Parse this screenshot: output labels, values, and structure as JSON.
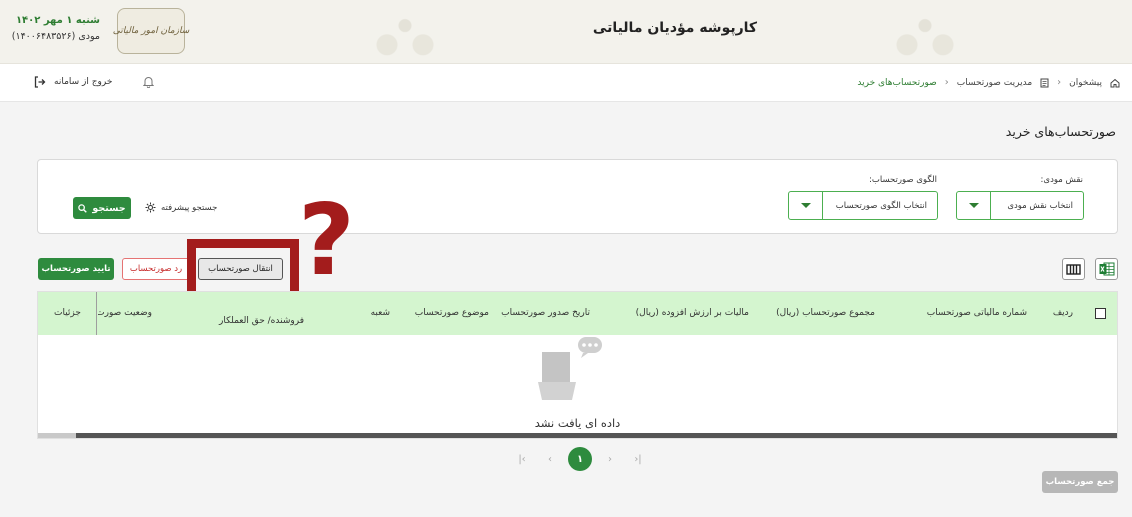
{
  "header": {
    "title": "کارپوشه مؤدیان مالیاتی",
    "date": "شنبه ۱ مهر ۱۴۰۲",
    "user": "مودی (۱۴۰۰۶۴۸۳۵۲۶)",
    "logo_text": "سازمان امور مالیاتی"
  },
  "nav": {
    "logout_label": "خروج از سامانه",
    "breadcrumb": [
      "پیشخوان",
      "مدیریت صورتحساب",
      "صورتحساب‌های خرید"
    ]
  },
  "page": {
    "title": "صورتحساب‌های خرید"
  },
  "filters": {
    "role_label": "نقش مودی:",
    "role_value": "انتخاب نقش مودی",
    "pattern_label": "الگوی صورتحساب:",
    "pattern_value": "انتخاب الگوی صورتحساب",
    "advanced_label": "جستجو پیشرفته",
    "search_label": "جستجو"
  },
  "actions": {
    "confirm_label": "تایید صورتحساب",
    "reject_label": "رد صورتحساب",
    "transfer_label": "انتقال صورتحساب",
    "sum_label": "جمع صورتحساب"
  },
  "annotation": {
    "question": "?"
  },
  "table": {
    "columns": [
      "ردیف",
      "شماره مالیاتی صورتحساب",
      "مجموع صورتحساب (ریال)",
      "مالیات بر ارزش افزوده (ریال)",
      "تاریخ صدور صورتحساب",
      "موضوع صورتحساب",
      "شعبه",
      "فروشنده/ حق العملکار",
      "وضعیت صورت",
      "جزئیات"
    ],
    "empty_message": "داده ای یافت نشد"
  },
  "pagination": {
    "current": "۱",
    "first": "|‹",
    "prev": "‹",
    "next": "›",
    "last": "›|"
  },
  "colors": {
    "brand_green": "#2e8b3e",
    "header_green": "#d4f5cf",
    "annotation_red": "#a31c1c"
  }
}
